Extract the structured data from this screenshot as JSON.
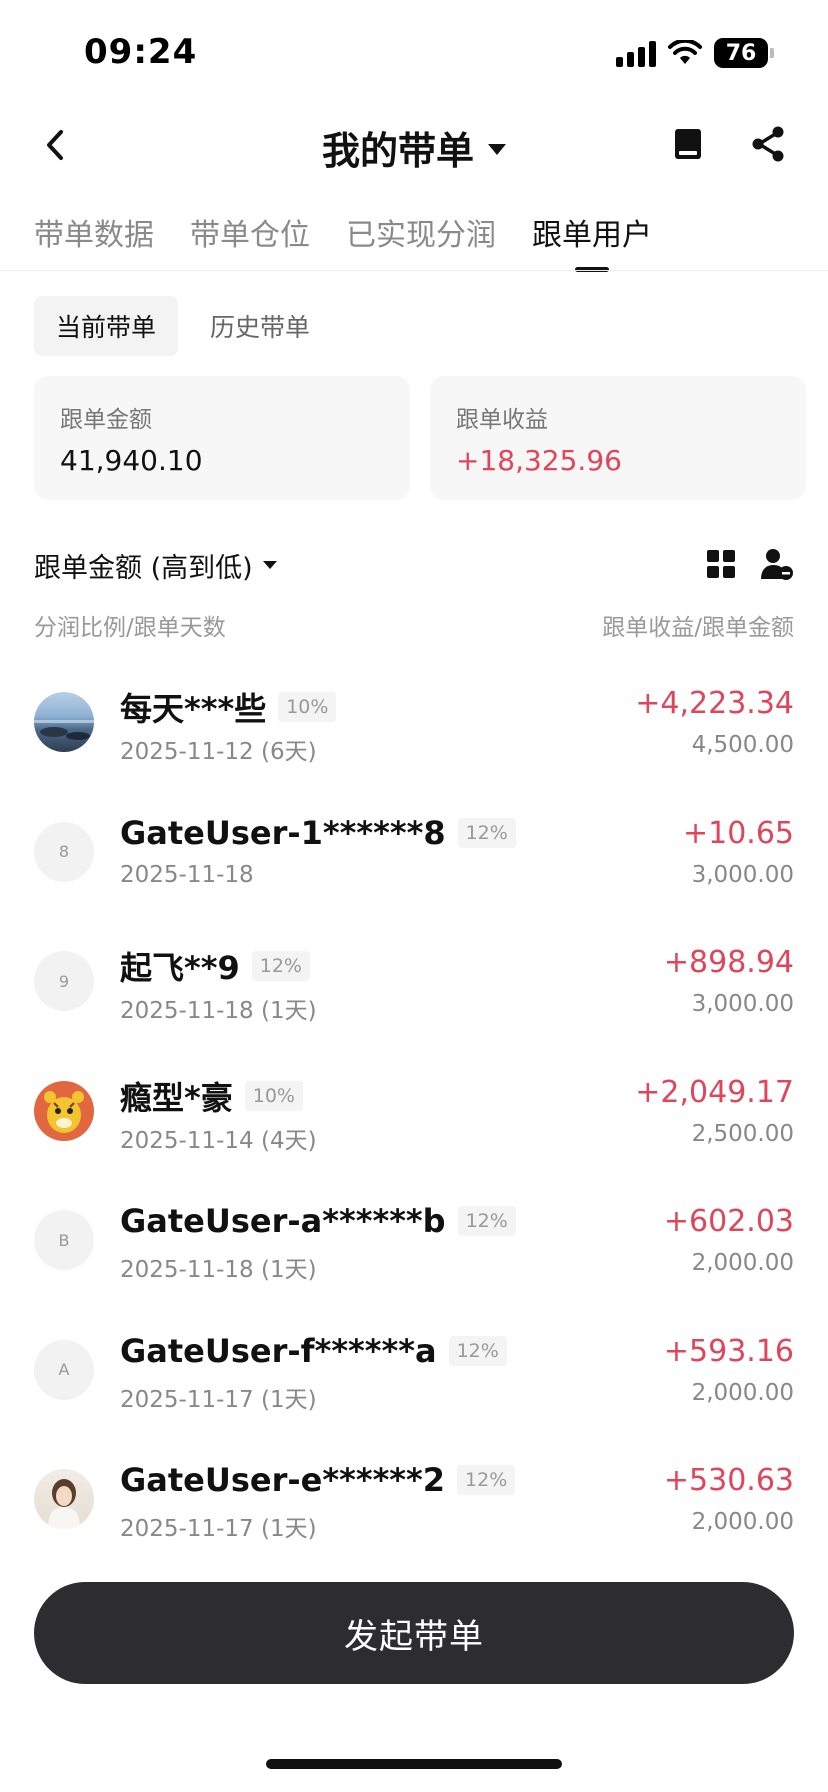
{
  "status_bar": {
    "time": "09:24",
    "battery": "76"
  },
  "header": {
    "title": "我的带单"
  },
  "main_tabs": [
    {
      "label": "带单数据",
      "active": false
    },
    {
      "label": "带单仓位",
      "active": false
    },
    {
      "label": "已实现分润",
      "active": false
    },
    {
      "label": "跟单用户",
      "active": true
    }
  ],
  "sub_tabs": [
    {
      "label": "当前带单",
      "active": true
    },
    {
      "label": "历史带单",
      "active": false
    }
  ],
  "summary": {
    "amount_label": "跟单金额",
    "amount_value": "41,940.10",
    "profit_label": "跟单收益",
    "profit_value": "+18,325.96"
  },
  "sort": {
    "label": "跟单金额 (高到低)"
  },
  "columns": {
    "left": "分润比例/跟单天数",
    "right": "跟单收益/跟单金额"
  },
  "followers": [
    {
      "name": "每天***些",
      "ratio": "10%",
      "date": "2025-11-12 (6天)",
      "profit": "+4,223.34",
      "amount": "4,500.00",
      "avatar_text": "",
      "avatar": "photo-sea"
    },
    {
      "name": "GateUser-1******8",
      "ratio": "12%",
      "date": "2025-11-18",
      "profit": "+10.65",
      "amount": "3,000.00",
      "avatar_text": "8",
      "avatar": "initial"
    },
    {
      "name": "起飞**9",
      "ratio": "12%",
      "date": "2025-11-18 (1天)",
      "profit": "+898.94",
      "amount": "3,000.00",
      "avatar_text": "9",
      "avatar": "initial"
    },
    {
      "name": "瘾型*豪",
      "ratio": "10%",
      "date": "2025-11-14 (4天)",
      "profit": "+2,049.17",
      "amount": "2,500.00",
      "avatar_text": "",
      "avatar": "photo-tiger"
    },
    {
      "name": "GateUser-a******b",
      "ratio": "12%",
      "date": "2025-11-18 (1天)",
      "profit": "+602.03",
      "amount": "2,000.00",
      "avatar_text": "B",
      "avatar": "initial"
    },
    {
      "name": "GateUser-f******a",
      "ratio": "12%",
      "date": "2025-11-17 (1天)",
      "profit": "+593.16",
      "amount": "2,000.00",
      "avatar_text": "A",
      "avatar": "initial"
    },
    {
      "name": "GateUser-e******2",
      "ratio": "12%",
      "date": "2025-11-17 (1天)",
      "profit": "+530.63",
      "amount": "2,000.00",
      "avatar_text": "",
      "avatar": "photo-person"
    }
  ],
  "bottom": {
    "button_label": "发起带单"
  },
  "colors": {
    "profit": "#e0455a",
    "primary_button": "#2d2d30",
    "muted_text": "#888888"
  },
  "icons": {
    "back": "chevron-left-icon",
    "title_dropdown": "caret-down-icon",
    "book": "book-icon",
    "share": "share-icon",
    "grid": "grid-icon",
    "user_filter": "user-settings-icon"
  }
}
